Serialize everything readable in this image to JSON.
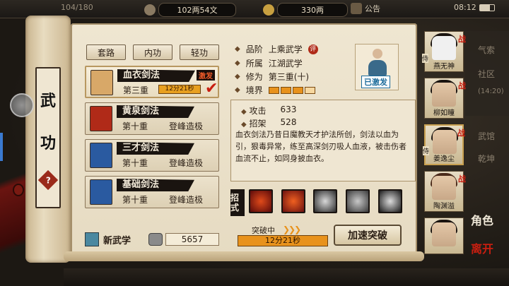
{
  "topbar": {
    "lv_text": "104/180",
    "money": "102两54文",
    "gold": "330两",
    "announce": "公告",
    "clock": "08:12"
  },
  "scroll": {
    "title_chars": [
      "武",
      "功"
    ],
    "help_glyph": "?"
  },
  "tabs": [
    {
      "label": "套路",
      "active": false
    },
    {
      "label": "内功",
      "active": false
    },
    {
      "label": "轻功",
      "active": false
    }
  ],
  "skills": [
    {
      "name": "血衣剑法",
      "level": "第三重",
      "status": "",
      "tag": "激发",
      "timer": "12分21秒",
      "selected": true,
      "book_color": "#b86a2a"
    },
    {
      "name": "黄泉剑法",
      "level": "第十重",
      "status": "登峰造极",
      "selected": false,
      "book_color": "#b02a18"
    },
    {
      "name": "三才剑法",
      "level": "第十重",
      "status": "登峰造极",
      "selected": false,
      "book_color": "#2a5aa0"
    },
    {
      "name": "基础剑法",
      "level": "第十重",
      "status": "登峰造极",
      "selected": false,
      "book_color": "#2a5aa0"
    }
  ],
  "new_skill": {
    "label": "新武学",
    "amount": "5657"
  },
  "detail": {
    "grade_label": "品阶",
    "grade_value": "上乘武学",
    "grade_badge": "评",
    "sect_label": "所属",
    "sect_value": "江湖武学",
    "cult_label": "修为",
    "cult_value": "第三重(十)",
    "realm_label": "境界",
    "realm_level": 3,
    "activated": "已激发",
    "attack_label": "攻击",
    "attack_value": "633",
    "parry_label": "招架",
    "parry_value": "528",
    "description": "血衣剑法乃昔日魔教天才护法所创，剑法以血为引，狠毒异常，练至高深剑刃吸人血液，被击伤者血流不止，如同身披血衣。"
  },
  "moves": {
    "label": "招式",
    "count": 6
  },
  "breakthrough": {
    "label": "突破中",
    "timer": "12分21秒",
    "accel_button": "加速突破"
  },
  "roster": [
    {
      "name": "燕无神",
      "tag": "战",
      "sub": "侍",
      "selected": false
    },
    {
      "name": "柳如瞳",
      "tag": "战",
      "sub": "",
      "selected": false
    },
    {
      "name": "姜逸尘",
      "tag": "战",
      "sub": "侍",
      "selected": true
    },
    {
      "name": "陶渊溢",
      "tag": "战",
      "sub": "",
      "selected": false
    },
    {
      "name": "",
      "tag": "",
      "sub": "",
      "selected": false
    }
  ],
  "side_menu": {
    "label1": "角色",
    "label2": "离开"
  },
  "right_hints": [
    "气索",
    "社区",
    "(14:20)",
    "武馆",
    "乾坤"
  ]
}
